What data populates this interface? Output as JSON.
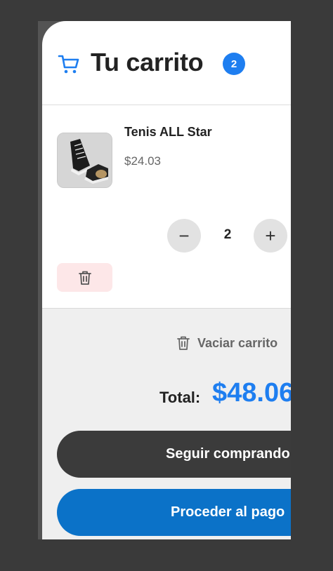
{
  "header": {
    "title": "Tu carrito",
    "count": "2"
  },
  "item": {
    "name": "Tenis ALL Star",
    "price": "$24.03",
    "quantity": "2",
    "decrement_label": "−",
    "increment_label": "+"
  },
  "footer": {
    "clear_label": "Vaciar carrito",
    "total_label": "Total:",
    "total_value": "$48.06",
    "continue_label": "Seguir comprando",
    "checkout_label": "Proceder al pago"
  },
  "colors": {
    "accent": "#1e7ef0",
    "checkout": "#0b72c8",
    "dark_button": "#3b3b3b",
    "delete_bg": "#fde7e8"
  },
  "icons": {
    "cart": "cart-icon",
    "trash": "trash-icon",
    "product": "sneaker-image"
  }
}
